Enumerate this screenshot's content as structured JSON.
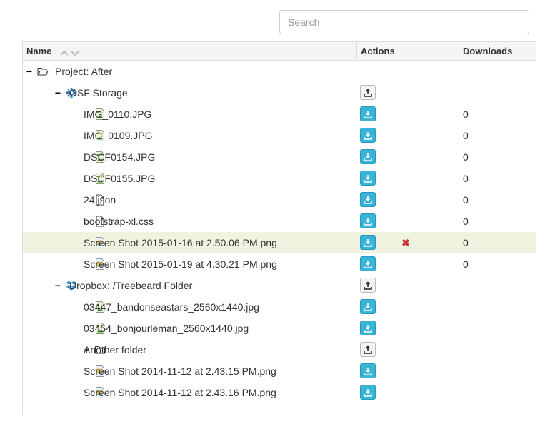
{
  "search": {
    "placeholder": "Search"
  },
  "columns": {
    "name": "Name",
    "actions": "Actions",
    "downloads": "Downloads"
  },
  "rows": [
    {
      "toggle": "−",
      "icon": "folder-open-icon",
      "label": "Project: After",
      "action": "",
      "downloads": ""
    },
    {
      "toggle": "−",
      "icon": "osf-storage-icon",
      "label": "OSF Storage",
      "action": "upload",
      "downloads": ""
    },
    {
      "toggle": "",
      "icon": "image-file-icon",
      "label": "IMG_0110.JPG",
      "action": "download",
      "downloads": "0"
    },
    {
      "toggle": "",
      "icon": "image-file-icon",
      "label": "IMG_0109.JPG",
      "action": "download",
      "downloads": "0"
    },
    {
      "toggle": "",
      "icon": "image-file-icon",
      "label": "DSCF0154.JPG",
      "action": "download",
      "downloads": "0"
    },
    {
      "toggle": "",
      "icon": "image-file-icon",
      "label": "DSCF0155.JPG",
      "action": "download",
      "downloads": "0"
    },
    {
      "toggle": "",
      "icon": "file-icon",
      "label": "24.json",
      "action": "download",
      "downloads": "0"
    },
    {
      "toggle": "",
      "icon": "file-icon",
      "label": "bootstrap-xl.css",
      "action": "download",
      "downloads": "0"
    },
    {
      "toggle": "",
      "icon": "png-file-icon",
      "label": "Screen Shot 2015-01-16 at 2.50.06 PM.png",
      "action": "download",
      "delete": "✖",
      "downloads": "0",
      "highlight": true
    },
    {
      "toggle": "",
      "icon": "png-file-icon",
      "label": "Screen Shot 2015-01-19 at 4.30.21 PM.png",
      "action": "download",
      "downloads": "0"
    },
    {
      "toggle": "−",
      "icon": "dropbox-icon",
      "label": "Dropbox: /Treebeard Folder",
      "action": "upload",
      "downloads": ""
    },
    {
      "toggle": "",
      "icon": "image-file-icon",
      "label": "03447_bandonseastars_2560x1440.jpg",
      "action": "download",
      "downloads": ""
    },
    {
      "toggle": "",
      "icon": "image-file-icon",
      "label": "03454_bonjourleman_2560x1440.jpg",
      "action": "download",
      "downloads": ""
    },
    {
      "toggle": "+",
      "icon": "folder-icon",
      "label": "Another folder",
      "action": "upload",
      "downloads": ""
    },
    {
      "toggle": "",
      "icon": "png-file-icon",
      "label": "Screen Shot 2014-11-12 at 2.43.15 PM.png",
      "action": "download",
      "downloads": ""
    },
    {
      "toggle": "",
      "icon": "png-file-icon",
      "label": "Screen Shot 2014-11-12 at 2.43.16 PM.png",
      "action": "download",
      "downloads": ""
    }
  ],
  "colors": {
    "download_button": "#39b3d7",
    "highlight_row": "#f1f3e1",
    "delete": "#cc3333"
  }
}
